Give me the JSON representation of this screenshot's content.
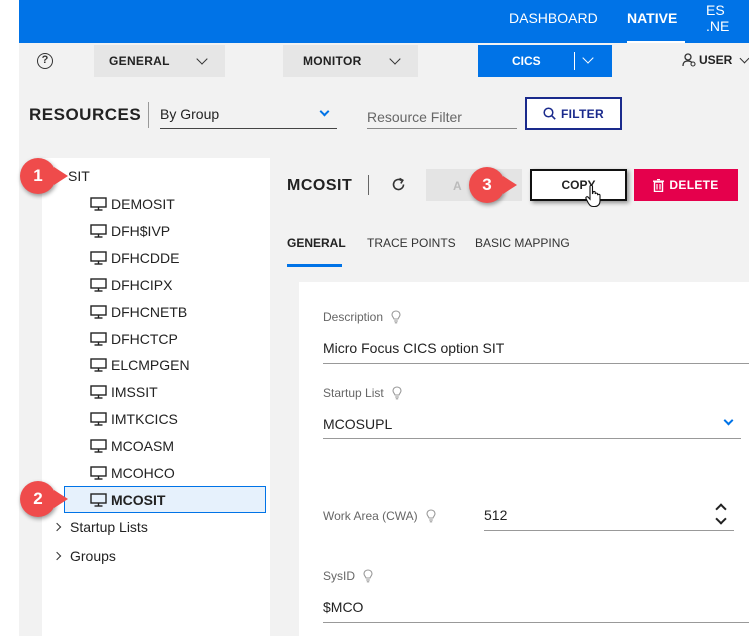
{
  "topnav": {
    "dashboard": "DASHBOARD",
    "native": "NATIVE",
    "esnet": "ES .NE"
  },
  "subbar": {
    "help": "?",
    "general": "GENERAL",
    "monitor": "MONITOR",
    "cics": "CICS",
    "user": "USER"
  },
  "resources": {
    "title": "RESOURCES",
    "group_by": "By Group",
    "filter_placeholder": "Resource Filter",
    "filter_button": "FILTER"
  },
  "tree": {
    "root": "SIT",
    "items": [
      "DEMOSIT",
      "DFH$IVP",
      "DFHCDDE",
      "DFHCIPX",
      "DFHCNETB",
      "DFHCTCP",
      "ELCMPGEN",
      "IMSSIT",
      "IMTKCICS",
      "MCOASM",
      "MCOHCO",
      "MCOSIT"
    ],
    "selected": "MCOSIT",
    "startup_lists": "Startup Lists",
    "groups": "Groups"
  },
  "detail": {
    "title": "MCOSIT",
    "apply_label": "A",
    "copy_button": "COPY",
    "delete_button": "DELETE",
    "tabs": [
      "GENERAL",
      "TRACE POINTS",
      "BASIC MAPPING"
    ],
    "active_tab": "GENERAL"
  },
  "form": {
    "description_label": "Description",
    "description_value": "Micro Focus CICS option SIT",
    "startup_list_label": "Startup List",
    "startup_list_value": "MCOSUPL",
    "work_area_label": "Work Area (CWA)",
    "work_area_value": "512",
    "sysid_label": "SysID",
    "sysid_value": "$MCO"
  },
  "callouts": [
    "1",
    "2",
    "3"
  ],
  "colors": {
    "primary": "#0073e7",
    "delete": "#e5004c",
    "callout": "#ef4b4b",
    "filter_border": "#1a2a8c"
  }
}
